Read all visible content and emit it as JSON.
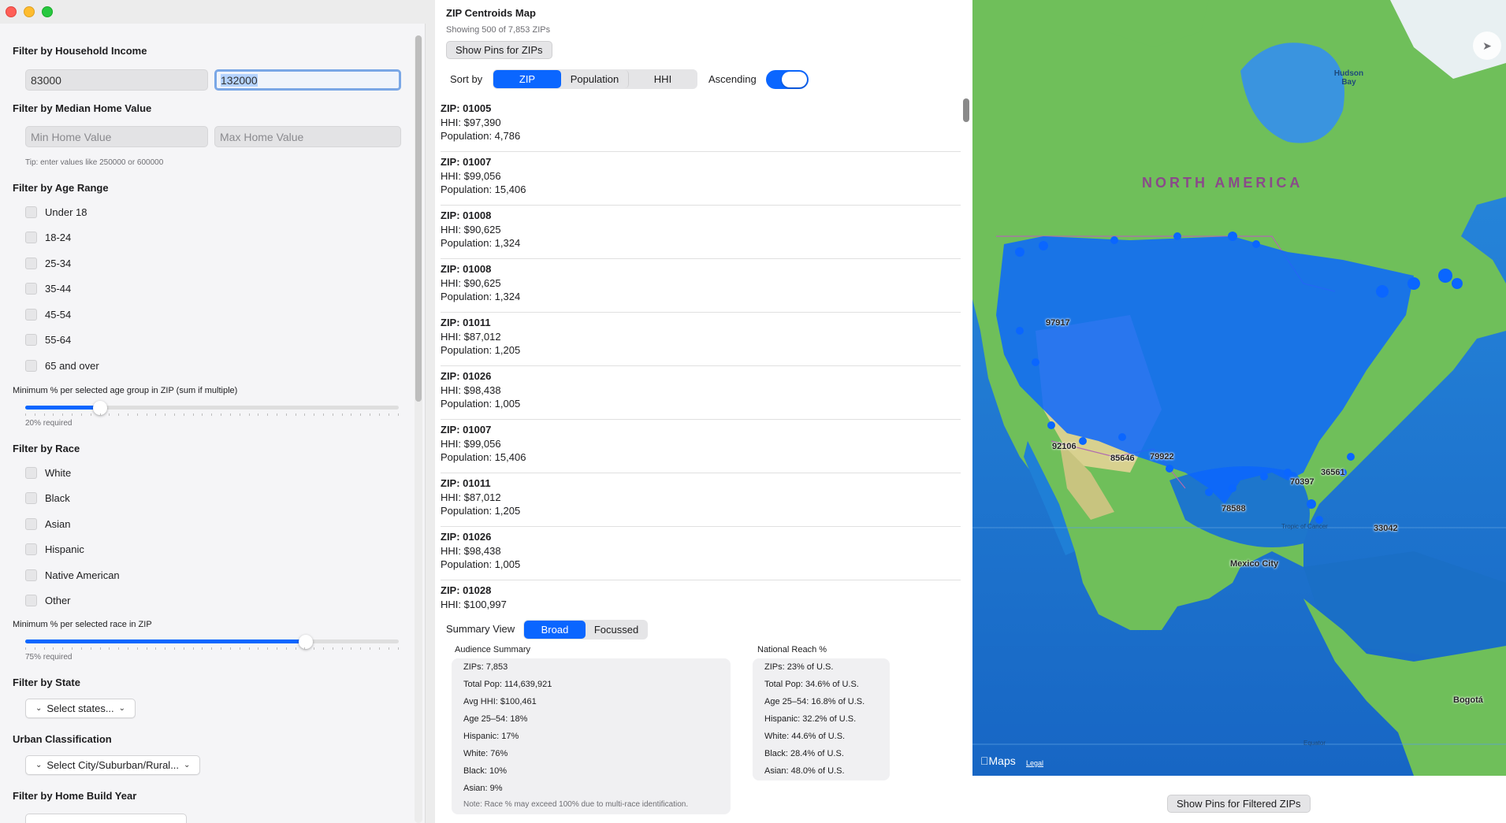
{
  "left": {
    "income": {
      "title": "Filter by Household Income",
      "min_value": "83000",
      "max_value": "132000"
    },
    "home_value": {
      "title": "Filter by Median Home Value",
      "min_placeholder": "Min Home Value",
      "max_placeholder": "Max Home Value",
      "tip": "Tip: enter values like 250000 or 600000"
    },
    "age": {
      "title": "Filter by Age Range",
      "options": [
        "Under 18",
        "18-24",
        "25-34",
        "35-44",
        "45-54",
        "55-64",
        "65 and over"
      ],
      "slider_label": "Minimum % per selected age group in ZIP (sum if multiple)",
      "slider_value": 0.2,
      "required": "20% required"
    },
    "race": {
      "title": "Filter by Race",
      "options": [
        "White",
        "Black",
        "Asian",
        "Hispanic",
        "Native American",
        "Other"
      ],
      "slider_label": "Minimum % per selected race in ZIP",
      "slider_value": 0.75,
      "required": "75% required"
    },
    "state": {
      "title": "Filter by State",
      "select": "Select states..."
    },
    "urban": {
      "title": "Urban Classification",
      "select": "Select City/Suburban/Rural..."
    },
    "build_year": {
      "title": "Filter by Home Build Year"
    }
  },
  "mid": {
    "title": "ZIP Centroids Map",
    "subtitle": "Showing 500 of 7,853 ZIPs",
    "show_pins": "Show Pins for ZIPs",
    "sort_label": "Sort by",
    "sort_options": [
      "ZIP",
      "Population",
      "HHI"
    ],
    "sort_active": "ZIP",
    "ascending_label": "Ascending",
    "ascending": true,
    "zips": [
      {
        "zip": "ZIP: 01005",
        "hhi": "HHI: $97,390",
        "pop": "Population: 4,786"
      },
      {
        "zip": "ZIP: 01007",
        "hhi": "HHI: $99,056",
        "pop": "Population: 15,406"
      },
      {
        "zip": "ZIP: 01008",
        "hhi": "HHI: $90,625",
        "pop": "Population: 1,324"
      },
      {
        "zip": "ZIP: 01008",
        "hhi": "HHI: $90,625",
        "pop": "Population: 1,324"
      },
      {
        "zip": "ZIP: 01011",
        "hhi": "HHI: $87,012",
        "pop": "Population: 1,205"
      },
      {
        "zip": "ZIP: 01026",
        "hhi": "HHI: $98,438",
        "pop": "Population: 1,005"
      },
      {
        "zip": "ZIP: 01007",
        "hhi": "HHI: $99,056",
        "pop": "Population: 15,406"
      },
      {
        "zip": "ZIP: 01011",
        "hhi": "HHI: $87,012",
        "pop": "Population: 1,205"
      },
      {
        "zip": "ZIP: 01026",
        "hhi": "HHI: $98,438",
        "pop": "Population: 1,005"
      },
      {
        "zip": "ZIP: 01028",
        "hhi": "HHI: $100,997",
        "pop": ""
      }
    ],
    "summary_view_label": "Summary View",
    "summary_options": [
      "Broad",
      "Focussed"
    ],
    "summary_active": "Broad",
    "audience": {
      "title": "Audience Summary",
      "lines": [
        "ZIPs: 7,853",
        "Total Pop: 114,639,921",
        "Avg HHI: $100,461",
        "Age 25–54: 18%",
        "Hispanic: 17%",
        "White: 76%",
        "Black: 10%",
        "Asian: 9%"
      ],
      "note": "Note: Race % may exceed 100% due to multi-race identification."
    },
    "reach": {
      "title": "National Reach %",
      "lines": [
        "ZIPs: 23% of U.S.",
        "Total Pop: 34.6% of U.S.",
        "Age 25–54: 16.8% of U.S.",
        "Hispanic: 32.2% of U.S.",
        "White: 44.6% of U.S.",
        "Black: 28.4% of U.S.",
        "Asian: 48.0% of U.S."
      ]
    }
  },
  "map": {
    "region": "NORTH AMERICA",
    "hudson": "Hudson Bay",
    "labels": [
      "97917",
      "92106",
      "85646",
      "79922",
      "78588",
      "70397",
      "36561",
      "33042",
      "Mexico City",
      "Bogotá"
    ],
    "tropic": "Tropic of Cancer",
    "equator": "Equator",
    "logo": "Maps",
    "legal": "Legal",
    "filtered_button": "Show Pins for Filtered ZIPs",
    "colors": {
      "water": "#1f7fd6",
      "land": "#6fbf5a",
      "pins": "#0a66ff"
    }
  }
}
